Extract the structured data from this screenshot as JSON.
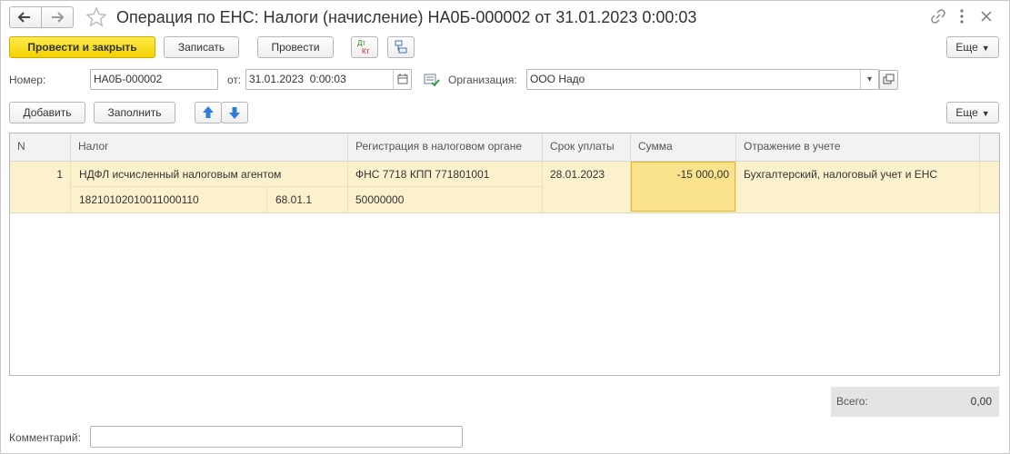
{
  "window": {
    "title": "Операция по ЕНС: Налоги (начисление) НА0Б-000002 от 31.01.2023 0:00:03"
  },
  "toolbar": {
    "post_close_label": "Провести и закрыть",
    "save_label": "Записать",
    "post_label": "Провести",
    "dtkt_top": "Дт",
    "dtkt_bottom": "Кт",
    "more_label": "Еще"
  },
  "form": {
    "number_label": "Номер:",
    "number_value": "НА0Б-000002",
    "date_label": "от:",
    "date_value": "31.01.2023  0:00:03",
    "org_label": "Организация:",
    "org_value": "ООО Надо"
  },
  "table_toolbar": {
    "add_label": "Добавить",
    "fill_label": "Заполнить",
    "more_label": "Еще"
  },
  "table": {
    "columns": [
      "N",
      "Налог",
      "Регистрация в налоговом органе",
      "Срок уплаты",
      "Сумма",
      "Отражение в учете"
    ],
    "rows": [
      {
        "n": "1",
        "tax": "НДФЛ исчисленный налоговым агентом",
        "kbk": "18210102010011000110",
        "account": "68.01.1",
        "registration": "ФНС 7718 КПП 771801001",
        "oktmo": "50000000",
        "due_date": "28.01.2023",
        "amount": "-15 000,00",
        "reflection": "Бухгалтерский, налоговый учет и ЕНС"
      }
    ]
  },
  "total": {
    "label": "Всего:",
    "value": "0,00"
  },
  "comment": {
    "label": "Комментарий:",
    "value": ""
  },
  "colors": {
    "primary_button": "#f3d100",
    "selected_row": "#fbf2cd",
    "active_cell": "#fbe38e",
    "active_cell_border": "#e8b927"
  }
}
